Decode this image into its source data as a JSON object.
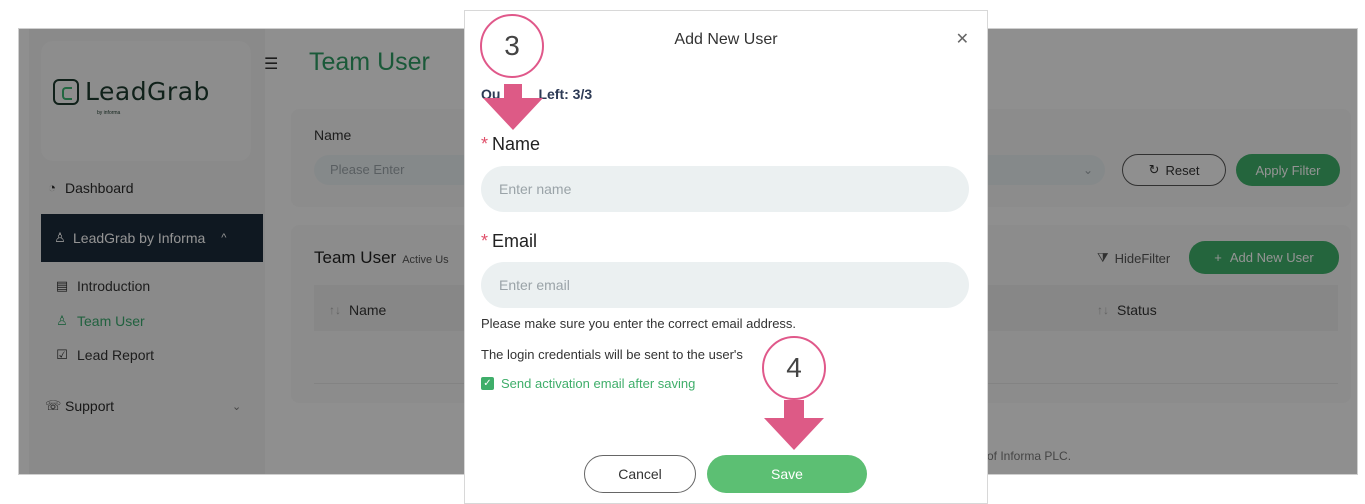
{
  "sidebar": {
    "logo_text": "LeadGrab",
    "logo_sub": "by informa",
    "items": [
      {
        "label": "Dashboard",
        "icon": "pie-chart-icon"
      },
      {
        "label": "LeadGrab by Informa",
        "icon": "users-icon"
      },
      {
        "label": "Introduction",
        "icon": "document-icon"
      },
      {
        "label": "Team User",
        "icon": "team-icon"
      },
      {
        "label": "Lead Report",
        "icon": "clipboard-icon"
      },
      {
        "label": "Support",
        "icon": "support-icon"
      }
    ]
  },
  "header": {
    "title": "Team User"
  },
  "filter": {
    "name_label": "Name",
    "name_placeholder": "Please Enter",
    "reset_label": "Reset",
    "apply_label": "Apply Filter"
  },
  "list": {
    "title": "Team User",
    "subtitle": "Active Us",
    "hide_filter_label": "HideFilter",
    "add_user_label": "Add New User",
    "columns": [
      "Name",
      "Status"
    ]
  },
  "footer": {
    "text": "of Informa PLC."
  },
  "modal": {
    "title": "Add New User",
    "quota_partial_left": "Qu",
    "quota_partial_right": "Left: 3/3",
    "name_label": "Name",
    "name_placeholder": "Enter name",
    "email_label": "Email",
    "email_placeholder": "Enter email",
    "note1": "Please make sure you enter the correct email address.",
    "note2": "The login credentials will be sent to the user's",
    "checkbox_label": "Send activation email after saving",
    "checkbox_checked": true,
    "cancel_label": "Cancel",
    "save_label": "Save"
  },
  "annotations": {
    "step3": "3",
    "step4": "4"
  },
  "colors": {
    "accent": "#3fae6a",
    "annotation": "#dd5a86",
    "sidebar_active": "#1b2a3a"
  }
}
